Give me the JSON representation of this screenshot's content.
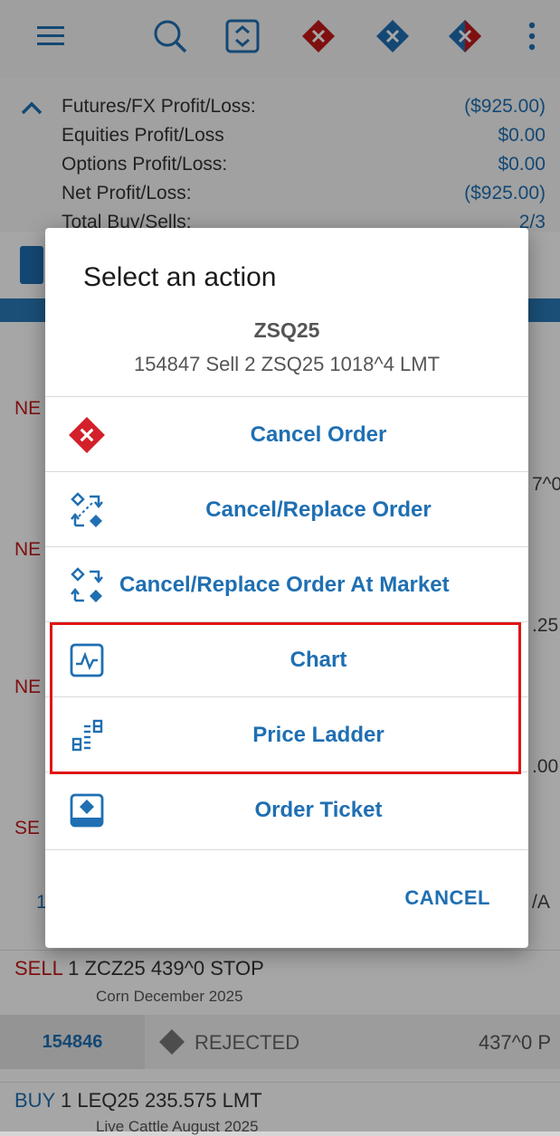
{
  "toolbar": {
    "icons": [
      "menu-icon",
      "search-icon",
      "expand-collapse-icon",
      "cancel-all-icon",
      "cancel-buys-icon",
      "cancel-sells-icon",
      "more-vert-icon"
    ]
  },
  "summary": {
    "rows": [
      {
        "label": "Futures/FX Profit/Loss:",
        "value": "($925.00)"
      },
      {
        "label": "Equities Profit/Loss",
        "value": "$0.00"
      },
      {
        "label": "Options Profit/Loss:",
        "value": "$0.00"
      },
      {
        "label": "Net Profit/Loss:",
        "value": "($925.00)"
      },
      {
        "label": "Total Buy/Sells:",
        "value": "2/3"
      }
    ]
  },
  "background_fragments": {
    "ne1": "NE",
    "ne2": "NE",
    "ne3": "NE",
    "se": "SE",
    "r1": "7^0",
    "r2": ".25",
    "r3": ".00",
    "r4": "/A",
    "one": "1"
  },
  "orders": [
    {
      "side": "SELL",
      "qty": "1",
      "desc": "ZCZ25 439^0 STOP",
      "sub": "Corn December 2025",
      "id": "154846",
      "status": "REJECTED",
      "price": "437^0 P"
    },
    {
      "side": "BUY",
      "qty": "1",
      "desc": "LEQ25 235.575 LMT",
      "sub": "Live Cattle August 2025"
    }
  ],
  "dialog": {
    "title": "Select an action",
    "symbol": "ZSQ25",
    "description": "154847 Sell 2  ZSQ25 1018^4 LMT",
    "items": [
      {
        "label": "Cancel Order",
        "icon": "cancel-order-icon"
      },
      {
        "label": "Cancel/Replace Order",
        "icon": "cancel-replace-icon"
      },
      {
        "label": "Cancel/Replace Order At Market",
        "icon": "cancel-replace-market-icon"
      },
      {
        "label": "Chart",
        "icon": "chart-icon"
      },
      {
        "label": "Price Ladder",
        "icon": "price-ladder-icon"
      },
      {
        "label": "Order Ticket",
        "icon": "order-ticket-icon"
      }
    ],
    "cancel_label": "CANCEL"
  },
  "colors": {
    "accent": "#1f6fb2",
    "sell": "#c41a1a",
    "highlight": "#e01515"
  }
}
